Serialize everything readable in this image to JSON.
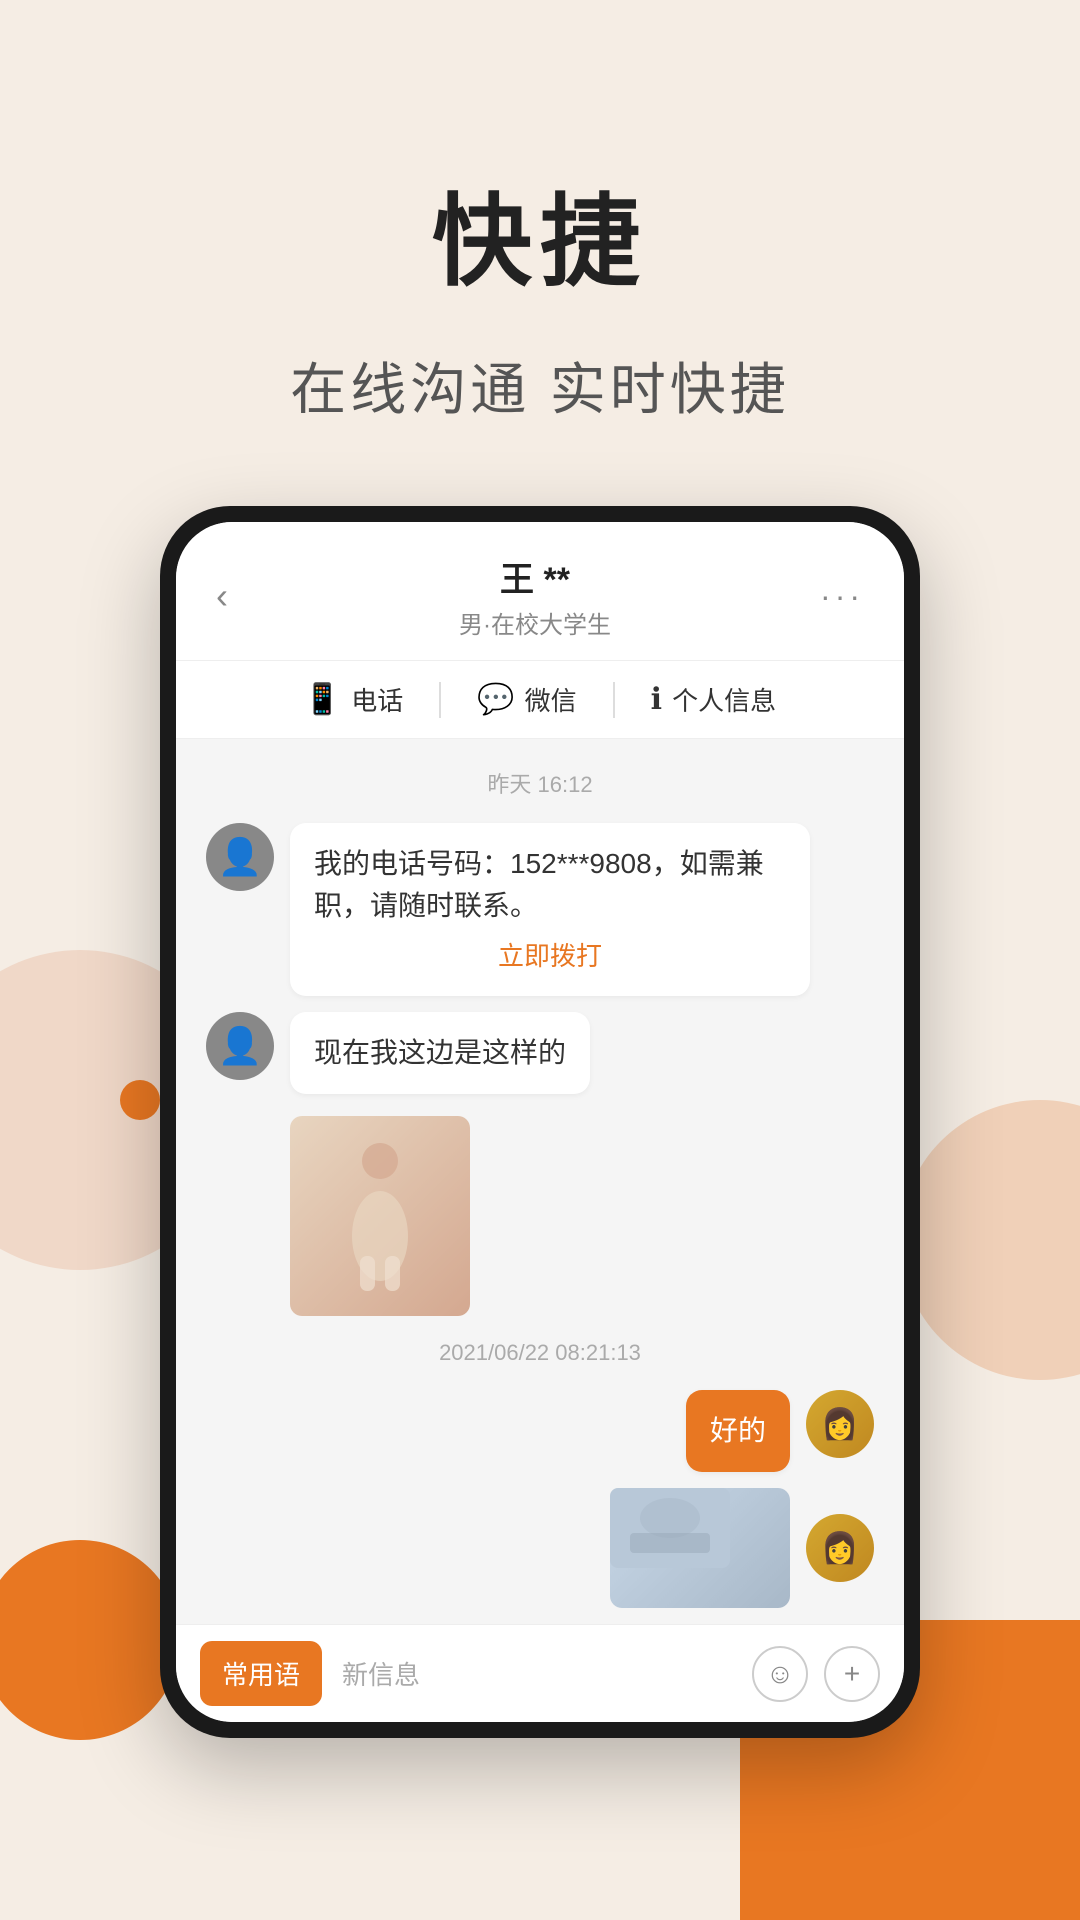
{
  "page": {
    "bg_color": "#f5ede4"
  },
  "hero": {
    "main_title": "快捷",
    "subtitle": "在线沟通  实时快捷"
  },
  "chat": {
    "back_icon": "‹",
    "contact_name": "王 **",
    "contact_desc": "男·在校大学生",
    "more_icon": "···",
    "actions": [
      {
        "icon": "📱",
        "label": "电话"
      },
      {
        "icon": "💬",
        "label": "微信"
      },
      {
        "icon": "ℹ",
        "label": "个人信息"
      }
    ],
    "timestamp1": "昨天 16:12",
    "msg1_text": "我的电话号码：152***9808，如需兼职，请随时联系。",
    "msg1_call": "立即拨打",
    "msg2_text": "现在我这边是这样的",
    "timestamp2": "2021/06/22 08:21:13",
    "msg3_text": "好的",
    "input_bar": {
      "quick_label": "常用语",
      "new_msg_label": "新信息",
      "emoji_icon": "☺",
      "add_icon": "+"
    }
  }
}
